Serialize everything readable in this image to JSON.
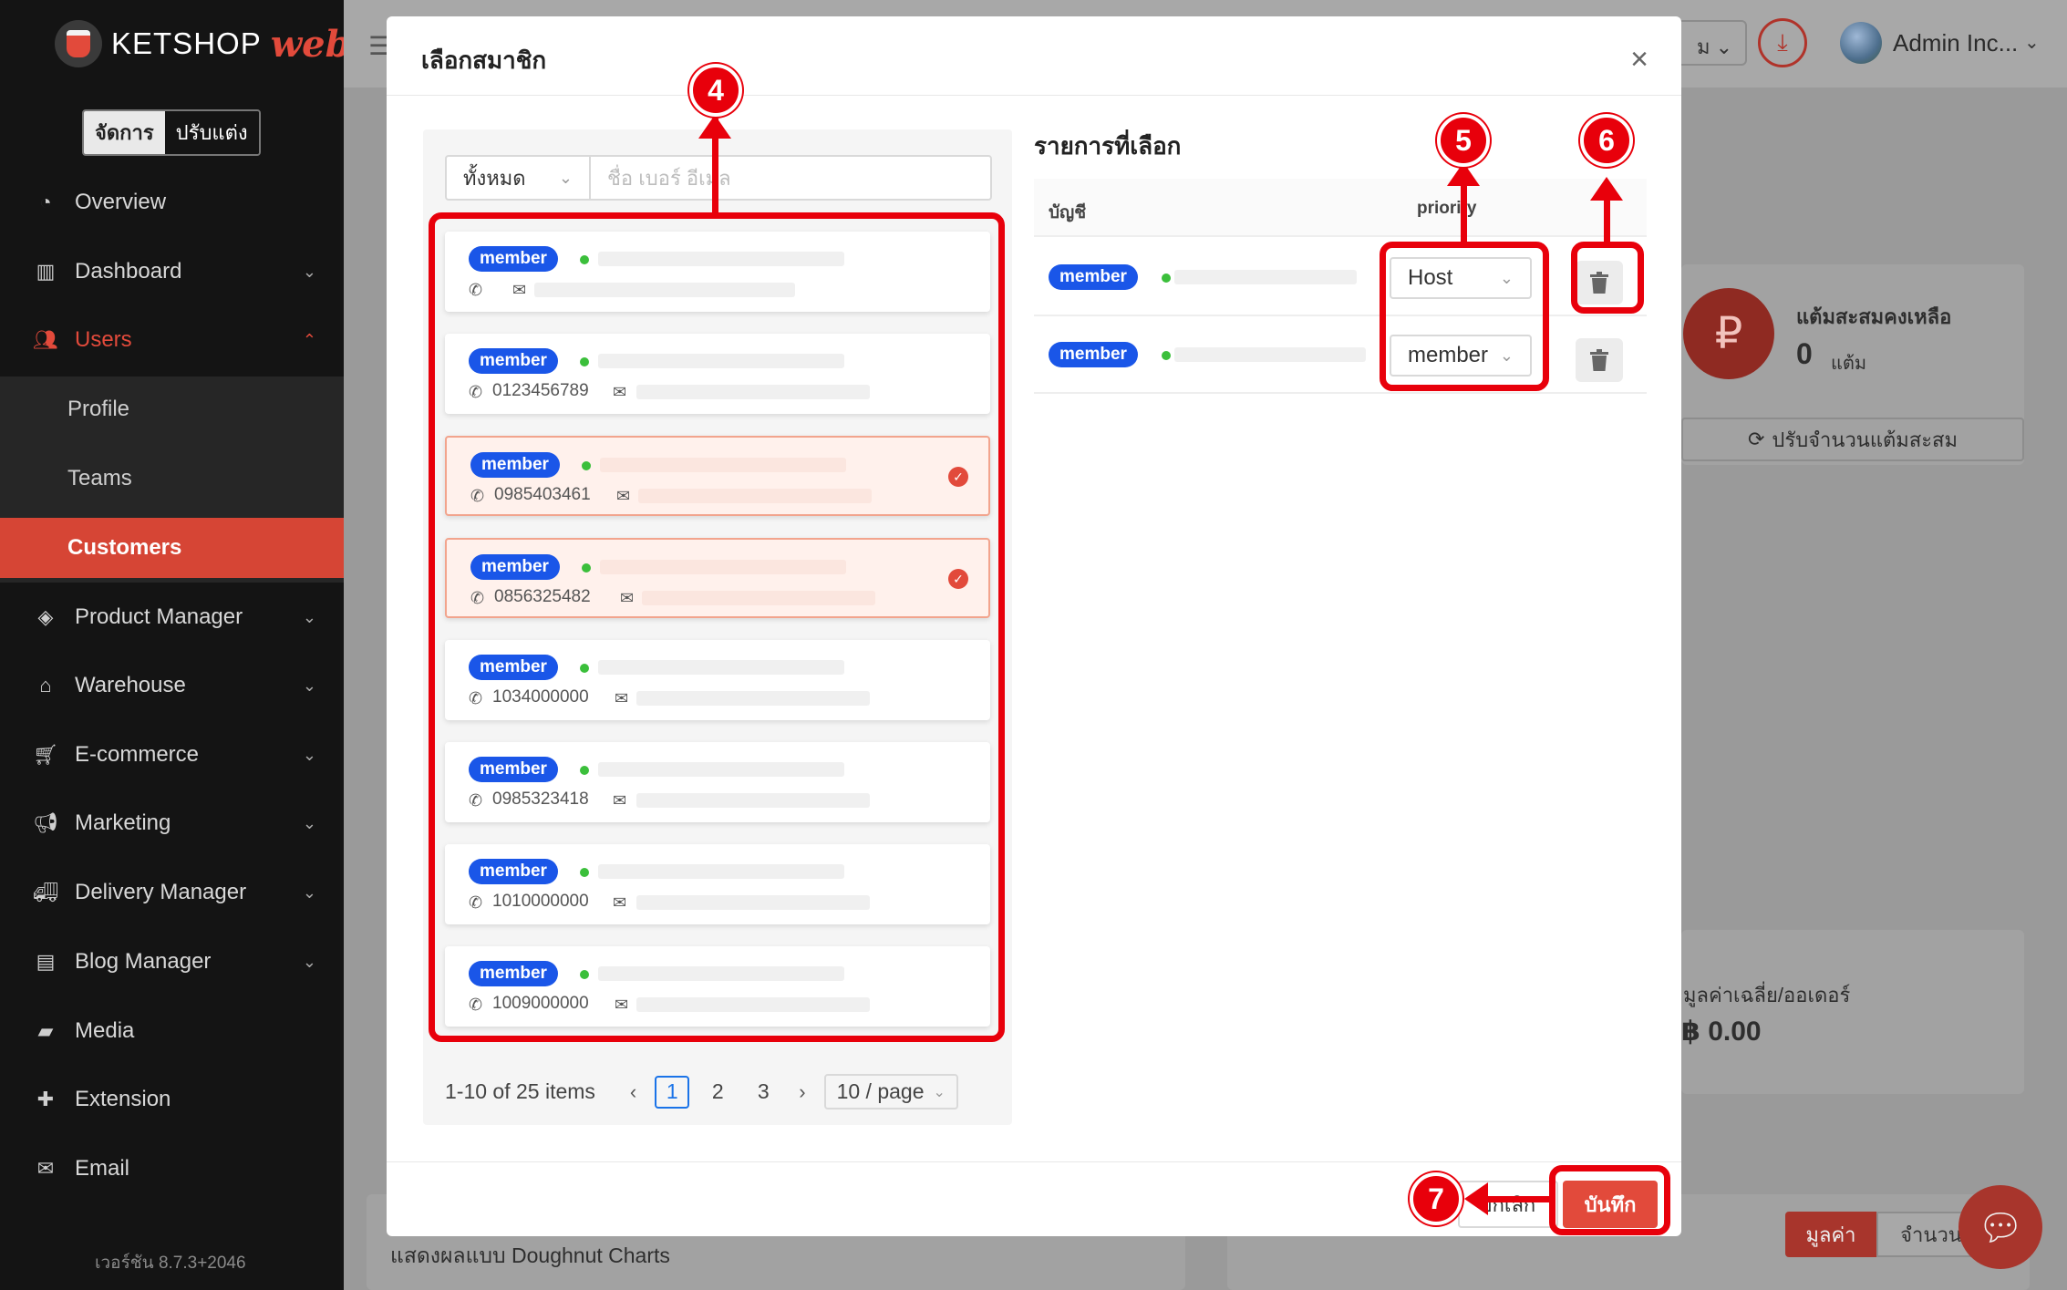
{
  "brand": {
    "name": "KETSHOP",
    "suffix": "web"
  },
  "mode_toggle": {
    "active": "จัดการ",
    "inactive": "ปรับแต่ง"
  },
  "sidebar": {
    "items": [
      {
        "label": "Overview",
        "icon": "pie-chart-icon"
      },
      {
        "label": "Dashboard",
        "icon": "bar-chart-icon"
      },
      {
        "label": "Users",
        "icon": "users-icon"
      },
      {
        "label": "Product Manager",
        "icon": "tag-icon"
      },
      {
        "label": "Warehouse",
        "icon": "warehouse-icon"
      },
      {
        "label": "E-commerce",
        "icon": "cart-icon"
      },
      {
        "label": "Marketing",
        "icon": "megaphone-icon"
      },
      {
        "label": "Delivery Manager",
        "icon": "truck-icon"
      },
      {
        "label": "Blog Manager",
        "icon": "blog-icon"
      },
      {
        "label": "Media",
        "icon": "folder-icon"
      },
      {
        "label": "Extension",
        "icon": "puzzle-icon"
      },
      {
        "label": "Email",
        "icon": "mail-icon"
      }
    ],
    "submenu": [
      "Profile",
      "Teams",
      "Customers"
    ],
    "version": "เวอร์ชัน 8.7.3+2046"
  },
  "topbar": {
    "select_text": "ม",
    "admin": "Admin Inc..."
  },
  "background": {
    "points_label": "แต้มสะสมคงเหลือ",
    "points_value": "0",
    "points_unit": "แต้ม",
    "adjust_points": "ปรับจำนวนแต้มสะสม",
    "avg_order_label": "มูลค่าเฉลี่ย/ออเดอร์",
    "avg_order_value": "฿ 0.00",
    "doughnut_text": "แสดงผลแบบ Doughnut Charts",
    "tab_value": "มูลค่า",
    "tab_count": "จำนวน"
  },
  "modal": {
    "title": "เลือกสมาชิก",
    "filter": {
      "select": "ทั้งหมด",
      "placeholder": "ชื่อ เบอร์ อีเมล"
    },
    "members": [
      {
        "badge": "member",
        "phone": "",
        "selected": false
      },
      {
        "badge": "member",
        "phone": "0123456789",
        "selected": false
      },
      {
        "badge": "member",
        "phone": "0985403461",
        "selected": true
      },
      {
        "badge": "member",
        "phone": "0856325482",
        "selected": true
      },
      {
        "badge": "member",
        "phone": "1034000000",
        "selected": false
      },
      {
        "badge": "member",
        "phone": "0985323418",
        "selected": false
      },
      {
        "badge": "member",
        "phone": "1010000000",
        "selected": false
      },
      {
        "badge": "member",
        "phone": "1009000000",
        "selected": false
      }
    ],
    "pagination": {
      "total": "1-10 of 25 items",
      "pages": [
        "1",
        "2",
        "3"
      ],
      "current": "1",
      "page_size": "10 / page"
    },
    "selected_title": "รายการที่เลือก",
    "columns": {
      "account": "บัญชี",
      "priority": "priority"
    },
    "selected_rows": [
      {
        "badge": "member",
        "priority": "Host"
      },
      {
        "badge": "member",
        "priority": "member"
      }
    ],
    "cancel": "ยกเลิก",
    "save": "บันทึก"
  },
  "annotations": [
    "4",
    "5",
    "6",
    "7"
  ],
  "colors": {
    "accent": "#e24a3b",
    "badge": "#1a56e8",
    "annotation": "#e8000b",
    "online": "#3bbf3b"
  }
}
